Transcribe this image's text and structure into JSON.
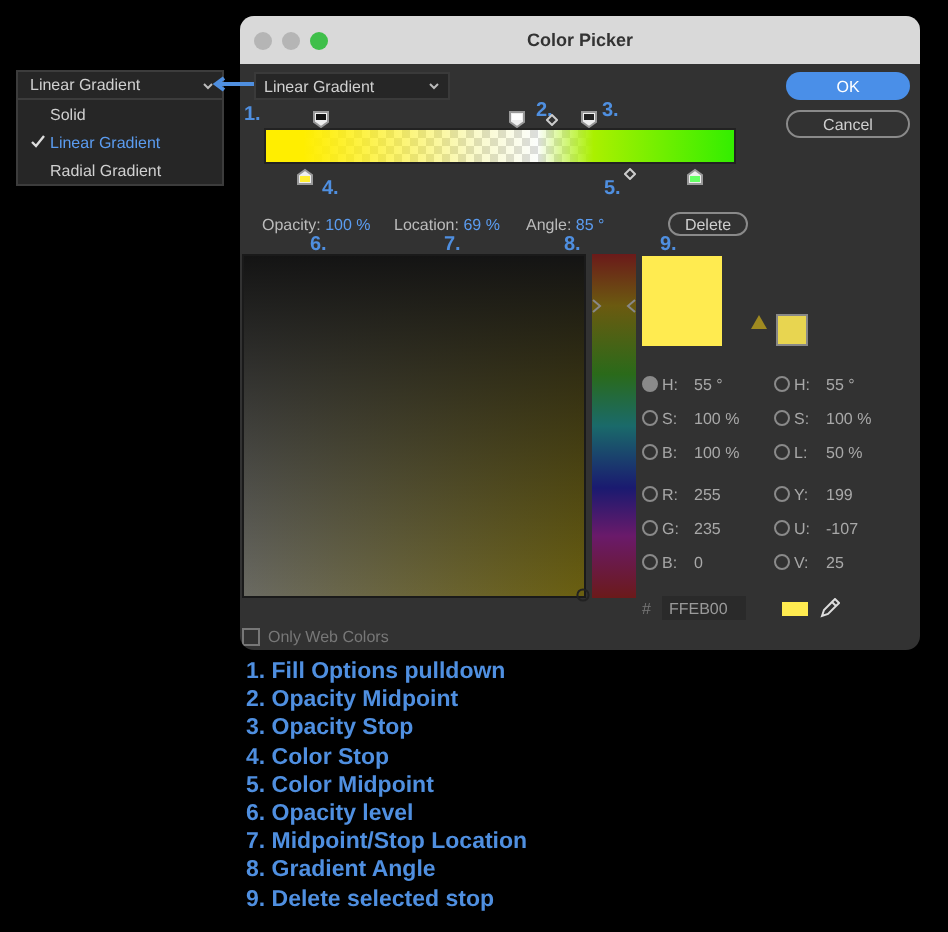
{
  "fill_menu": {
    "value": "Linear Gradient",
    "options": [
      {
        "label": "Solid",
        "selected": false
      },
      {
        "label": "Linear Gradient",
        "selected": true
      },
      {
        "label": "Radial Gradient",
        "selected": false
      }
    ]
  },
  "window": {
    "title": "Color Picker"
  },
  "fill_dropdown": {
    "value": "Linear Gradient"
  },
  "callouts": [
    "1.",
    "2.",
    "3.",
    "4.",
    "5.",
    "6.",
    "7.",
    "8.",
    "9."
  ],
  "readouts": [
    {
      "label": "Opacity:",
      "value": "100 %"
    },
    {
      "label": "Location:",
      "value": "69 %"
    },
    {
      "label": "Angle:",
      "value": "85 °"
    }
  ],
  "delete_button": "Delete",
  "buttons": {
    "ok": "OK",
    "cancel": "Cancel"
  },
  "color_fields": [
    {
      "label": "H:",
      "value": "55 °",
      "selected": true
    },
    {
      "label": "H:",
      "value": "55 °",
      "selected": false
    },
    {
      "label": "S:",
      "value": "100 %",
      "selected": false
    },
    {
      "label": "S:",
      "value": "100 %",
      "selected": false
    },
    {
      "label": "B:",
      "value": "100 %",
      "selected": false
    },
    {
      "label": "L:",
      "value": "50 %",
      "selected": false
    },
    {
      "label": "R:",
      "value": "255",
      "selected": false
    },
    {
      "label": "Y:",
      "value": "199",
      "selected": false
    },
    {
      "label": "G:",
      "value": "235",
      "selected": false
    },
    {
      "label": "U:",
      "value": "-107",
      "selected": false
    },
    {
      "label": "B:",
      "value": "0",
      "selected": false
    },
    {
      "label": "V:",
      "value": "25",
      "selected": false
    }
  ],
  "hex": {
    "label": "#",
    "value": "FFEB00"
  },
  "hue_slider": {
    "level": 0.85
  },
  "web_colors": {
    "label": "Only Web Colors",
    "checked": false
  },
  "legend": [
    "1. Fill Options pulldown",
    "2. Opacity Midpoint",
    "3. Opacity Stop",
    "4. Color Stop",
    "5. Color Midpoint",
    "6. Opacity level",
    "7. Midpoint/Stop Location",
    "8. Gradient Angle",
    "9. Delete selected stop"
  ]
}
